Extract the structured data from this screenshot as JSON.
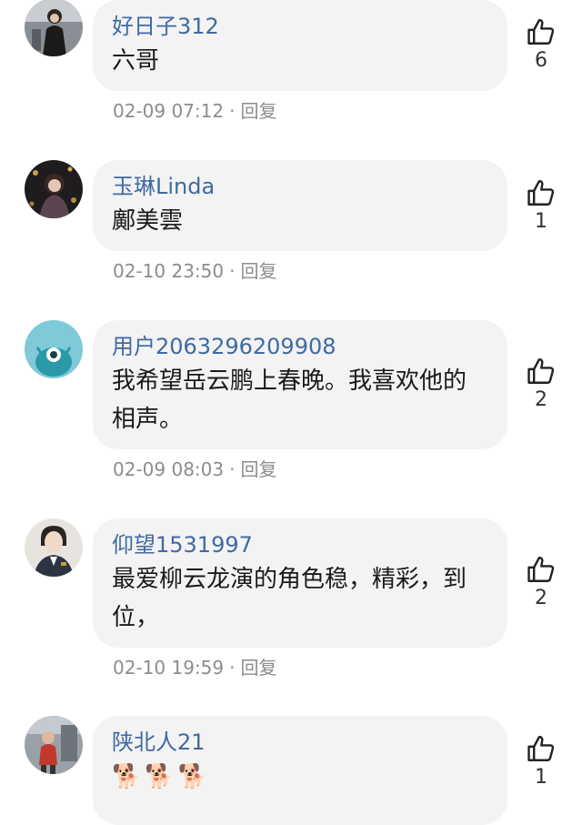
{
  "comments": [
    {
      "username": "好日子312",
      "text": "六哥",
      "time": "02-09 07:12",
      "separator": "·",
      "reply_label": "回复",
      "likes": "6"
    },
    {
      "username": "玉琳Linda",
      "text": "鄺美雲",
      "time": "02-10 23:50",
      "separator": "·",
      "reply_label": "回复",
      "likes": "1"
    },
    {
      "username": "用户2063296209908",
      "text": "我希望岳云鹏上春晚。我喜欢他的相声。",
      "time": "02-09 08:03",
      "separator": "·",
      "reply_label": "回复",
      "likes": "2"
    },
    {
      "username": "仰望1531997",
      "text": "最爱柳云龙演的角色稳，精彩，到位，",
      "time": "02-10 19:59",
      "separator": "·",
      "reply_label": "回复",
      "likes": "2"
    },
    {
      "username": "陕北人21",
      "emojis": [
        "🐕",
        "🐕",
        "🐕"
      ],
      "likes": "1"
    }
  ],
  "colors": {
    "username": "#3f6aa3",
    "bubble": "#f3f3f3",
    "meta": "#8c8c8c",
    "text": "#1a1a1a"
  },
  "icons": {
    "like": "thumbs-up-icon",
    "avatar": "avatar-image"
  }
}
